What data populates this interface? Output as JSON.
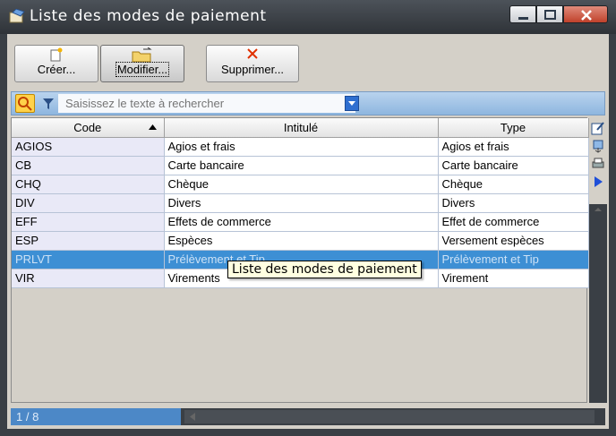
{
  "window": {
    "title": "Liste des modes de paiement"
  },
  "toolbar": {
    "create_label": "Créer...",
    "modify_label": "Modifier...",
    "delete_label": "Supprimer..."
  },
  "search": {
    "placeholder": "Saisissez le texte à rechercher"
  },
  "table": {
    "columns": [
      "Code",
      "Intitulé",
      "Type"
    ],
    "rows": [
      {
        "code": "AGIOS",
        "label": "Agios et frais",
        "type": "Agios et frais"
      },
      {
        "code": "CB",
        "label": "Carte bancaire",
        "type": "Carte bancaire"
      },
      {
        "code": "CHQ",
        "label": "Chèque",
        "type": "Chèque"
      },
      {
        "code": "DIV",
        "label": "Divers",
        "type": "Divers"
      },
      {
        "code": "EFF",
        "label": "Effets de commerce",
        "type": "Effet de commerce"
      },
      {
        "code": "ESP",
        "label": "Espèces",
        "type": "Versement espèces"
      },
      {
        "code": "PRLVT",
        "label": "Prélèvement et Tip",
        "type": "Prélèvement et Tip"
      },
      {
        "code": "VIR",
        "label": "Virements",
        "type": "Virement"
      }
    ],
    "selected_row": 6
  },
  "status": {
    "count": "1 / 8"
  },
  "tooltip": {
    "text": "Liste des modes de paiement"
  },
  "colors": {
    "selection": "#3d8fd4",
    "titlebar": "#3a3f45",
    "status_bg": "#4c88c7"
  }
}
